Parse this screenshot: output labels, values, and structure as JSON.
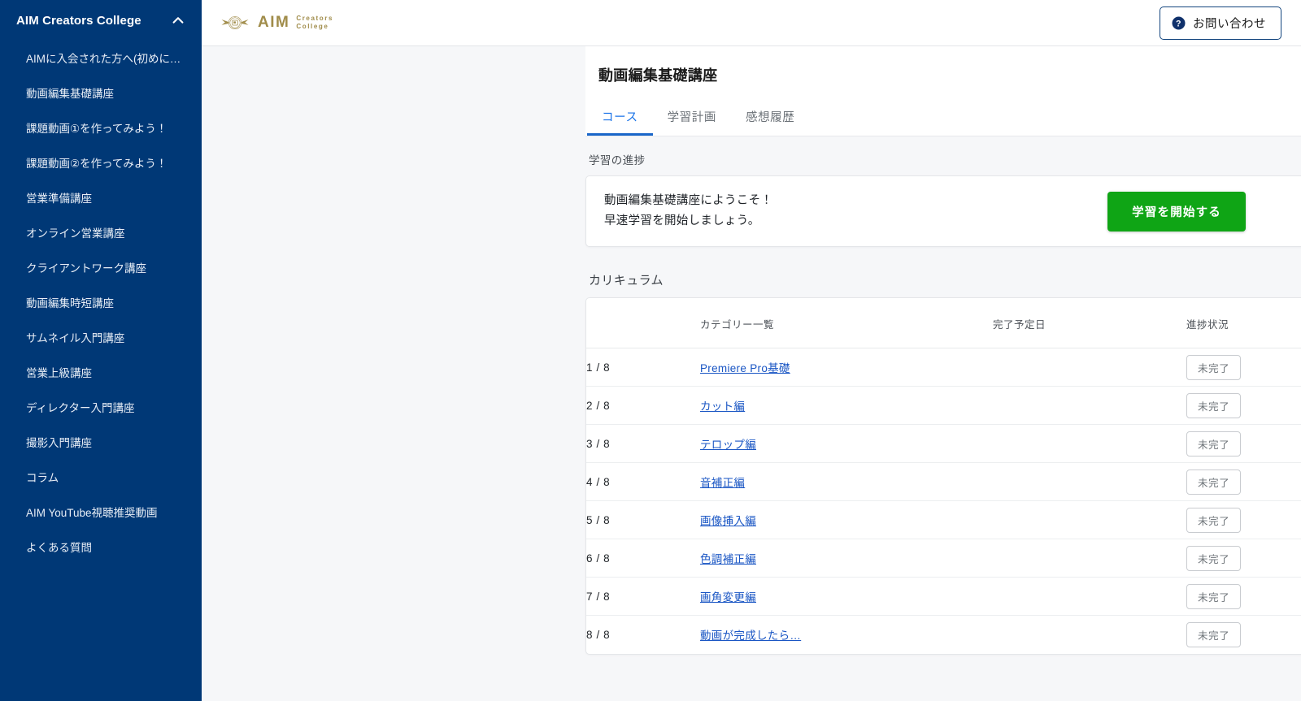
{
  "sidebar": {
    "title": "AIM Creators College",
    "collapse_icon": "chevron-up-icon",
    "items": [
      {
        "label": "AIMに入会された方へ(初めにご…"
      },
      {
        "label": "動画編集基礎講座"
      },
      {
        "label": "課題動画①を作ってみよう！"
      },
      {
        "label": "課題動画②を作ってみよう！"
      },
      {
        "label": "営業準備講座"
      },
      {
        "label": "オンライン営業講座"
      },
      {
        "label": "クライアントワーク講座"
      },
      {
        "label": "動画編集時短講座"
      },
      {
        "label": "サムネイル入門講座"
      },
      {
        "label": "営業上級講座"
      },
      {
        "label": "ディレクター入門講座"
      },
      {
        "label": "撮影入門講座"
      },
      {
        "label": "コラム"
      },
      {
        "label": "AIM YouTube視聴推奨動画"
      },
      {
        "label": "よくある質問"
      }
    ]
  },
  "topbar": {
    "logo_icon": "aim-crest-icon",
    "logo_main": "AIM",
    "logo_line1": "Creators",
    "logo_line2": "College",
    "contact_icon": "question-circle-icon",
    "contact_label": "お問い合わせ"
  },
  "page": {
    "title": "動画編集基礎講座",
    "tabs": [
      {
        "label": "コース",
        "active": true
      },
      {
        "label": "学習計画",
        "active": false
      },
      {
        "label": "感想履歴",
        "active": false
      }
    ],
    "progress_section_label": "学習の進捗",
    "welcome": {
      "line1": "動画編集基礎講座にようこそ！",
      "line2": "早速学習を開始しましょう。",
      "cta_label": "学習を開始する"
    },
    "curriculum_label": "カリキュラム",
    "table": {
      "headers": {
        "index": "",
        "category": "カテゴリー一覧",
        "due_date": "完了予定日",
        "status": "進捗状況"
      },
      "rows": [
        {
          "index": "1 / 8",
          "category": "Premiere Pro基礎",
          "due_date": "",
          "status": "未完了"
        },
        {
          "index": "2 / 8",
          "category": "カット編",
          "due_date": "",
          "status": "未完了"
        },
        {
          "index": "3 / 8",
          "category": "テロップ編",
          "due_date": "",
          "status": "未完了"
        },
        {
          "index": "4 / 8",
          "category": "音補正編",
          "due_date": "",
          "status": "未完了"
        },
        {
          "index": "5 / 8",
          "category": "画像挿入編",
          "due_date": "",
          "status": "未完了"
        },
        {
          "index": "6 / 8",
          "category": "色調補正編",
          "due_date": "",
          "status": "未完了"
        },
        {
          "index": "7 / 8",
          "category": "画角変更編",
          "due_date": "",
          "status": "未完了"
        },
        {
          "index": "8 / 8",
          "category": "動画が完成したら…",
          "due_date": "",
          "status": "未完了"
        }
      ]
    }
  },
  "colors": {
    "sidebar_bg": "#003876",
    "page_bg": "#f6f7f9",
    "brand_gold": "#a08c4a",
    "accent_blue": "#1a73e8",
    "link_blue": "#1a56c4",
    "cta_green": "#0fa515",
    "badge_gray": "#6d7378"
  }
}
